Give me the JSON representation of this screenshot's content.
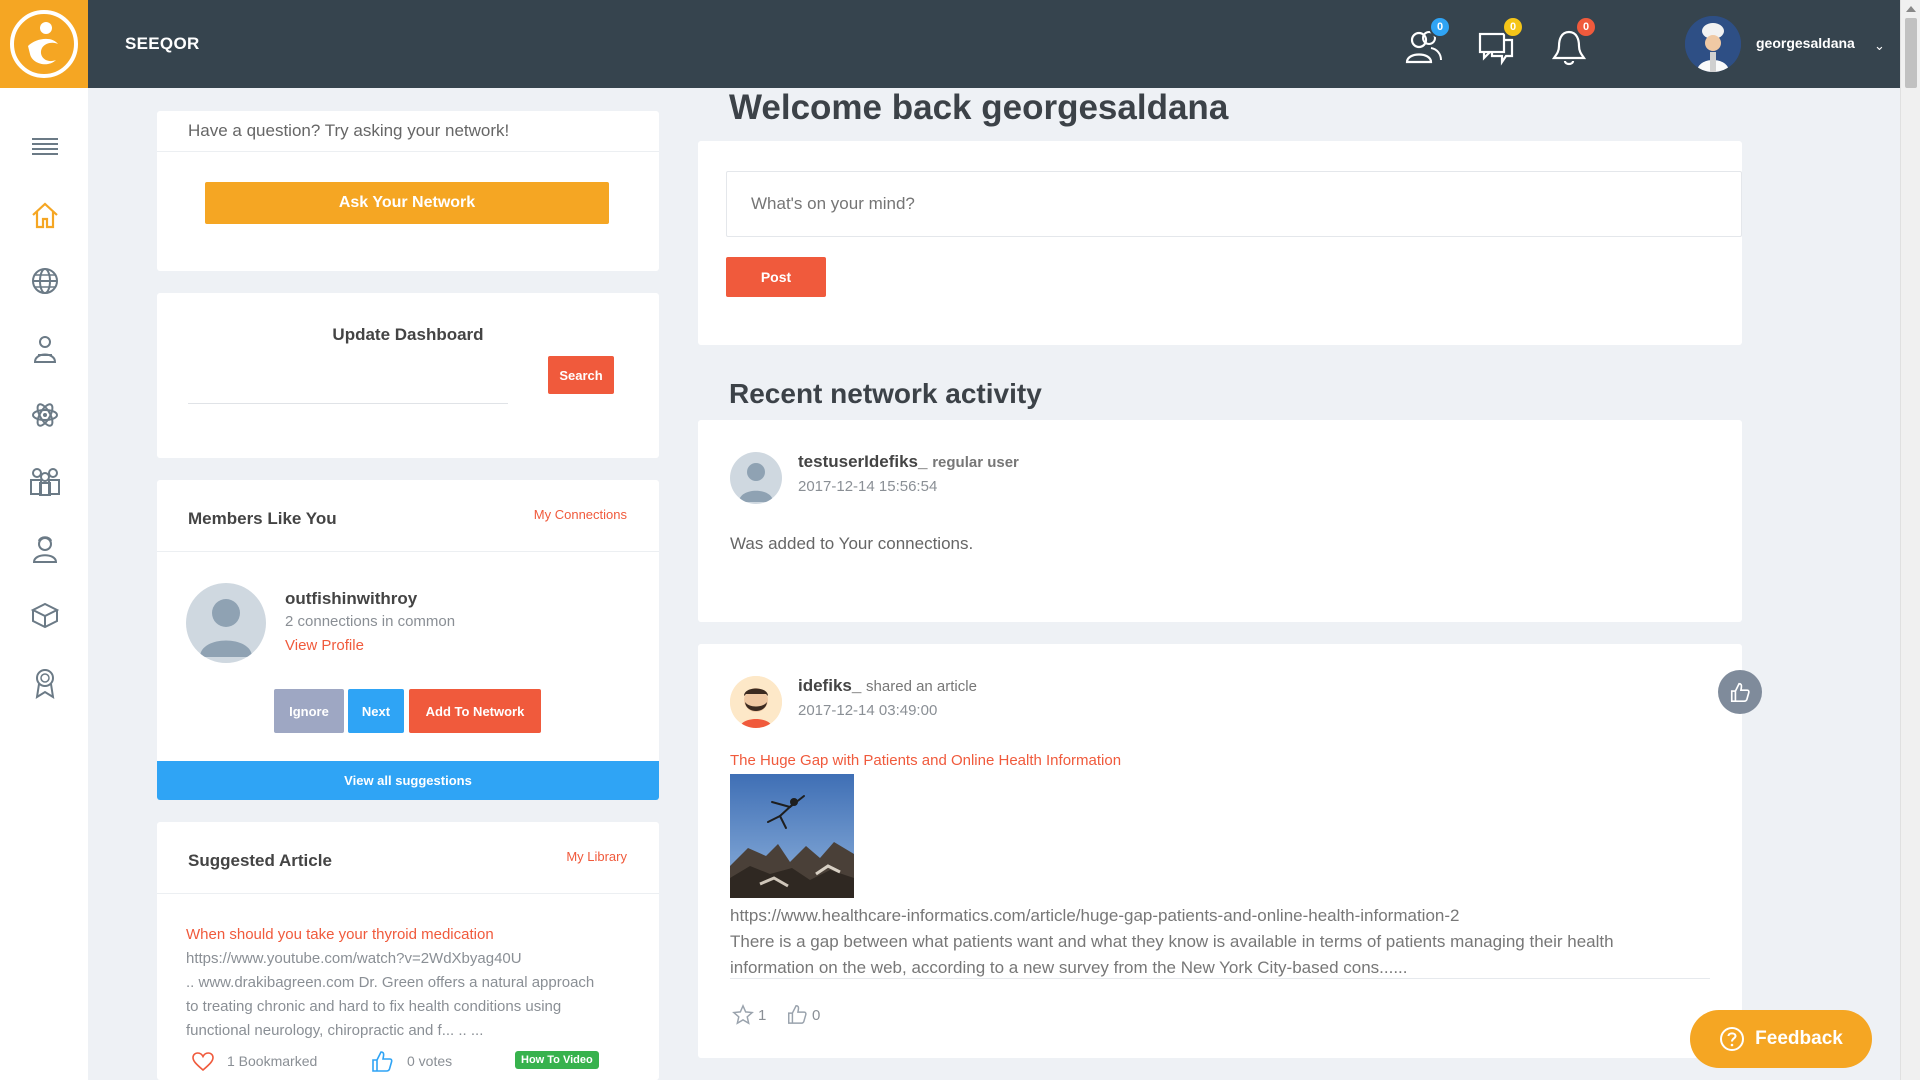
{
  "topbar": {
    "brand": "SEEQOR",
    "badges": {
      "connections": "0",
      "messages": "0",
      "notifications": "0"
    },
    "username": "georgesaldana"
  },
  "ask": {
    "prompt": "Have a question? Try asking your network!",
    "button": "Ask Your Network"
  },
  "update_dashboard": {
    "title": "Update Dashboard",
    "search_button": "Search",
    "search_placeholder": ""
  },
  "members": {
    "title": "Members Like You",
    "link": "My Connections",
    "member": {
      "name": "outfishinwithroy",
      "common": "2 connections in common",
      "view_profile": "View Profile"
    },
    "ignore": "Ignore",
    "next": "Next",
    "add": "Add To Network",
    "view_all": "View all suggestions"
  },
  "suggested": {
    "title": "Suggested Article",
    "link": "My Library",
    "article_title": "When should you take your thyroid medication",
    "article_url": "https://www.youtube.com/watch?v=2WdXbyag40U",
    "article_desc_1": ".. www.drakibagreen.com Dr. Green offers a natural approach",
    "article_desc_2": "to treating chronic and hard to fix health conditions using",
    "article_desc_3": "functional neurology, chiropractic and f... .. ...",
    "bookmarked": "1 Bookmarked",
    "votes": "0 votes",
    "tag": "How To Video"
  },
  "main": {
    "welcome": "Welcome back georgesaldana",
    "post_placeholder": "What's on your mind?",
    "post_button": "Post",
    "recent_title": "Recent network activity"
  },
  "activity": [
    {
      "user": "testuserIdefiks_",
      "role": "regular user",
      "time": "2017-12-14 15:56:54",
      "text": "Was added to Your connections."
    },
    {
      "user": "idefiks_",
      "action": "shared an article",
      "time": "2017-12-14 03:49:00",
      "article_title": "The Huge Gap with Patients and Online Health Information",
      "article_url": "https://www.healthcare-informatics.com/article/huge-gap-patients-and-online-health-information-2",
      "desc_1": "There is a gap between what patients want and what they know is available in terms of patients managing their health",
      "desc_2": "information on the web, according to a new survey from the New York City-based cons......",
      "stars": "1",
      "likes": "0"
    }
  ],
  "feedback": "Feedback",
  "colors": {
    "topbar": "#36444e",
    "accent_orange": "#f5a623",
    "accent_red": "#f05a3c",
    "accent_blue": "#2fa4f5",
    "ignore_gray": "#9ea7c3"
  }
}
